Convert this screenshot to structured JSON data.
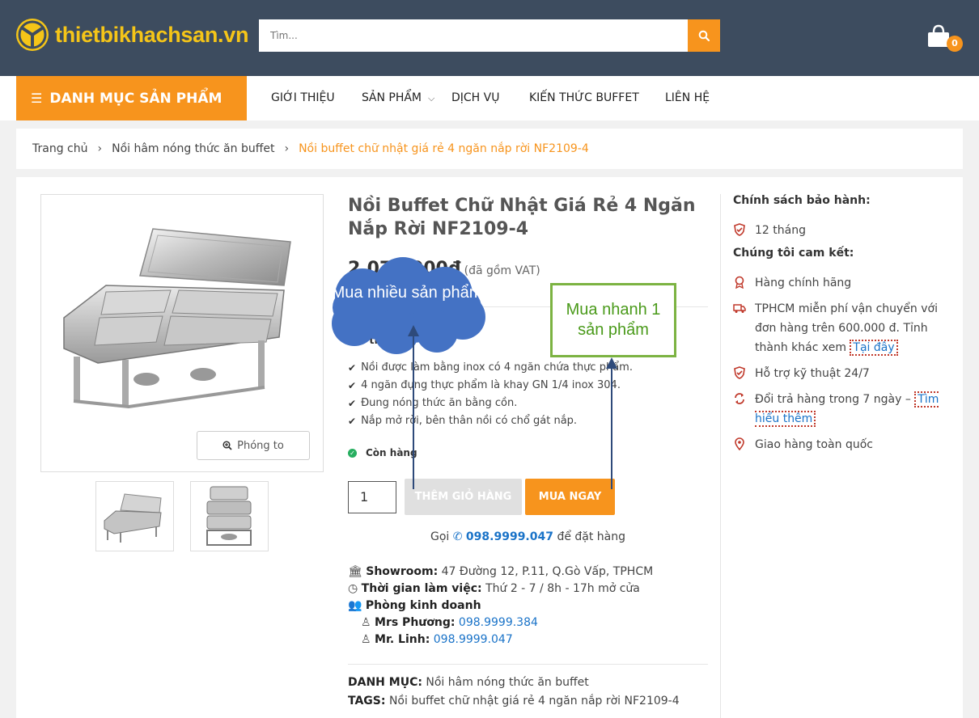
{
  "header": {
    "logo_text": "thietbikhachsan.vn",
    "search_placeholder": "Tìm...",
    "cart_count": "0"
  },
  "nav": {
    "category_label": "DANH MỤC SẢN PHẨM",
    "items": [
      "GIỚI THIỆU",
      "SẢN PHẨM",
      "DỊCH VỤ",
      "KIẾN THỨC BUFFET",
      "LIÊN HỆ"
    ]
  },
  "breadcrumb": {
    "home": "Trang chủ",
    "category": "Nồi hâm nóng thức ăn buffet",
    "current": "Nồi buffet chữ nhật giá rẻ 4 ngăn nắp rời NF2109-4"
  },
  "product": {
    "title": "Nồi Buffet Chữ Nhật Giá Rẻ 4 Ngăn Nắp Rời NF2109-4",
    "price": "2.070.000đ",
    "vat_note": "(đã gồm VAT)",
    "sku_label": "Mã th",
    "sku_value": "9-4",
    "features": [
      "Nồi được làm bằng inox có 4 ngăn chứa thực phẩm.",
      "4 ngăn đựng thực phẩm là khay GN 1/4 inox 304.",
      "Đung nóng thức ăn bằng cồn.",
      "Nắp mở rời, bên thân nồi có chổ gát nắp."
    ],
    "stock": "Còn hàng",
    "zoom_label": "Phóng to",
    "qty": "1",
    "add_to_cart": "THÊM GIỎ HÀNG",
    "buy_now": "MUA NGAY",
    "call_prefix": "Gọi",
    "call_phone": "098.9999.047",
    "call_suffix": "để đặt hàng"
  },
  "contact": {
    "showroom_label": "Showroom:",
    "showroom_value": "47 Đường 12, P.11, Q.Gò Vấp, TPHCM",
    "hours_label": "Thời gian làm việc:",
    "hours_value": "Thứ 2 - 7 / 8h - 17h mở cửa",
    "sales_label": "Phòng kinh doanh",
    "person1_label": "Mrs Phương:",
    "person1_phone": "098.9999.384",
    "person2_label": "Mr. Linh:",
    "person2_phone": "098.9999.047"
  },
  "meta": {
    "category_label": "DANH MỤC:",
    "category_value": "Nồi hâm nóng thức ăn buffet",
    "tags_label": "TAGS:",
    "tags_value": "Nồi buffet chữ nhật giá rẻ 4 ngăn nắp rời NF2109-4"
  },
  "sidebar": {
    "warranty_title": "Chính sách bảo hành:",
    "warranty_value": "12 tháng",
    "commit_title": "Chúng tôi cam kết:",
    "genuine": "Hàng chính hãng",
    "shipping_text": "TPHCM miễn phí vận chuyển với đơn hàng trên 600.000 đ. Tỉnh thành khác xem",
    "shipping_link": "Tại đây",
    "support": "Hỗ trợ kỹ thuật 24/7",
    "return_text": "Đổi trả hàng trong 7 ngày –",
    "return_link": "Tìm hiểu thêm",
    "delivery": "Giao hàng toàn quốc"
  },
  "annotations": {
    "cloud_text": "Mua nhiều sản phẩm",
    "box_text": "Mua nhanh 1 sản phẩm"
  },
  "colors": {
    "header_bg": "#3d4c5f",
    "accent": "#f7941d",
    "logo_yellow": "#f5c518",
    "link_blue": "#1a73c8",
    "cloud_blue": "#4472c4",
    "box_green": "#7cb342"
  }
}
